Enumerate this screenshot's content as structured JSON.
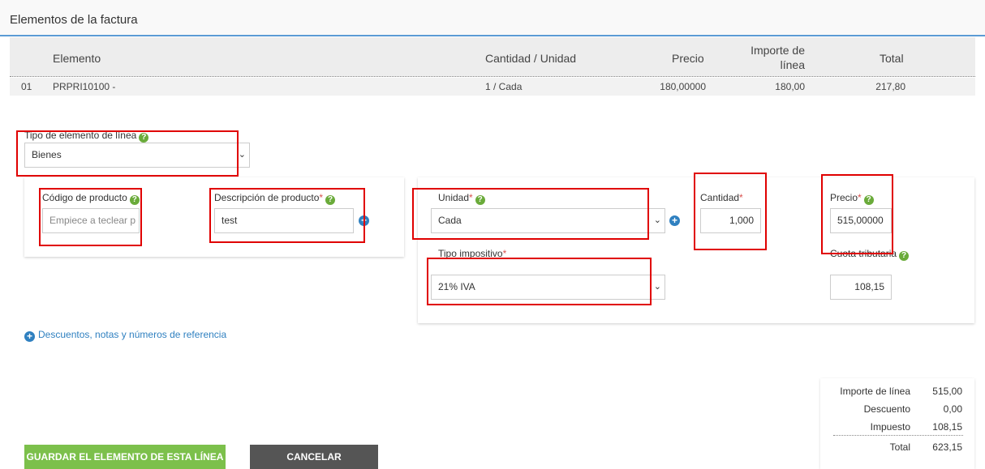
{
  "header": {
    "title": "Elementos de la factura"
  },
  "table": {
    "columns": {
      "element": "Elemento",
      "qty_unit": "Cantidad / Unidad",
      "price": "Precio",
      "line_amount_1": "Importe de",
      "line_amount_2": "línea",
      "total": "Total"
    },
    "rows": [
      {
        "num": "01",
        "code": "PRPRI10100 -",
        "qty_unit": "1 / Cada",
        "price": "180,00000",
        "line_amount": "180,00",
        "total": "217,80"
      }
    ]
  },
  "form": {
    "line_type": {
      "label": "Tipo de elemento de línea",
      "value": "Bienes"
    },
    "product_code": {
      "label": "Código de producto",
      "placeholder": "Empiece a teclear p"
    },
    "product_desc": {
      "label": "Descripción de producto",
      "required": "*",
      "value": "test"
    },
    "unit": {
      "label": "Unidad",
      "required": "*",
      "value": "Cada"
    },
    "quantity": {
      "label": "Cantidad",
      "required": "*",
      "value": "1,000"
    },
    "price": {
      "label": "Precio",
      "required": "*",
      "value": "515,00000"
    },
    "tax_type": {
      "label": "Tipo impositivo",
      "required": "*",
      "value": "21% IVA"
    },
    "tax_amount": {
      "label": "Cuota tributaria",
      "value": "108,15"
    },
    "help_glyph": "?",
    "plus_glyph": "+",
    "chevron_glyph": "⌄"
  },
  "links": {
    "discounts": "Descuentos, notas y números de referencia"
  },
  "summary": {
    "line_amount_label": "Importe de línea",
    "line_amount": "515,00",
    "discount_label": "Descuento",
    "discount": "0,00",
    "tax_label": "Impuesto",
    "tax": "108,15",
    "total_label": "Total",
    "total": "623,15"
  },
  "buttons": {
    "save": "GUARDAR EL ELEMENTO DE ESTA LÍNEA",
    "cancel": "CANCELAR"
  },
  "colors": {
    "accent": "#5b9bd5",
    "help": "#6aab3a",
    "link": "#2f80c0",
    "save": "#7cc04b",
    "cancel": "#555555",
    "highlight": "#e00000"
  }
}
